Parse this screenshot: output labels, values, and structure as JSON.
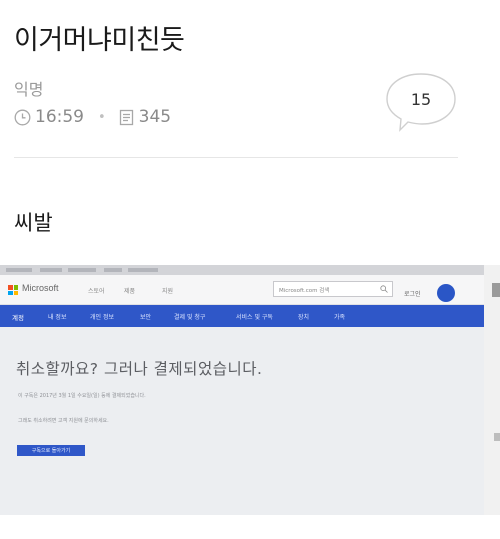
{
  "post": {
    "title": "이거머냐미친듯",
    "author": "익명",
    "time": "16:59",
    "views": "345",
    "comment_count": "15",
    "body": "씨발"
  },
  "photo": {
    "site": {
      "brand": "Microsoft",
      "nav": [
        "스토어",
        "제품",
        "지원"
      ],
      "search_placeholder": "Microsoft.com 검색",
      "login": "로그인",
      "avatar_color": "#2a56c6"
    },
    "account_nav": {
      "color": "#2f57c8",
      "items": [
        "계정",
        "내 정보",
        "개인 정보",
        "보안",
        "결제 및 청구",
        "서비스 및 구독",
        "장치",
        "가족"
      ]
    },
    "page": {
      "headline": "취소할까요? 그러나 결제되었습니다.",
      "line1": "이 구독은 2017년 3월 1일 수요일(일) 등에 결제되었습니다.",
      "line2": "그래도 취소하려면 고객 지원에 문의하세요.",
      "button": "구독으로 돌아가기"
    }
  }
}
